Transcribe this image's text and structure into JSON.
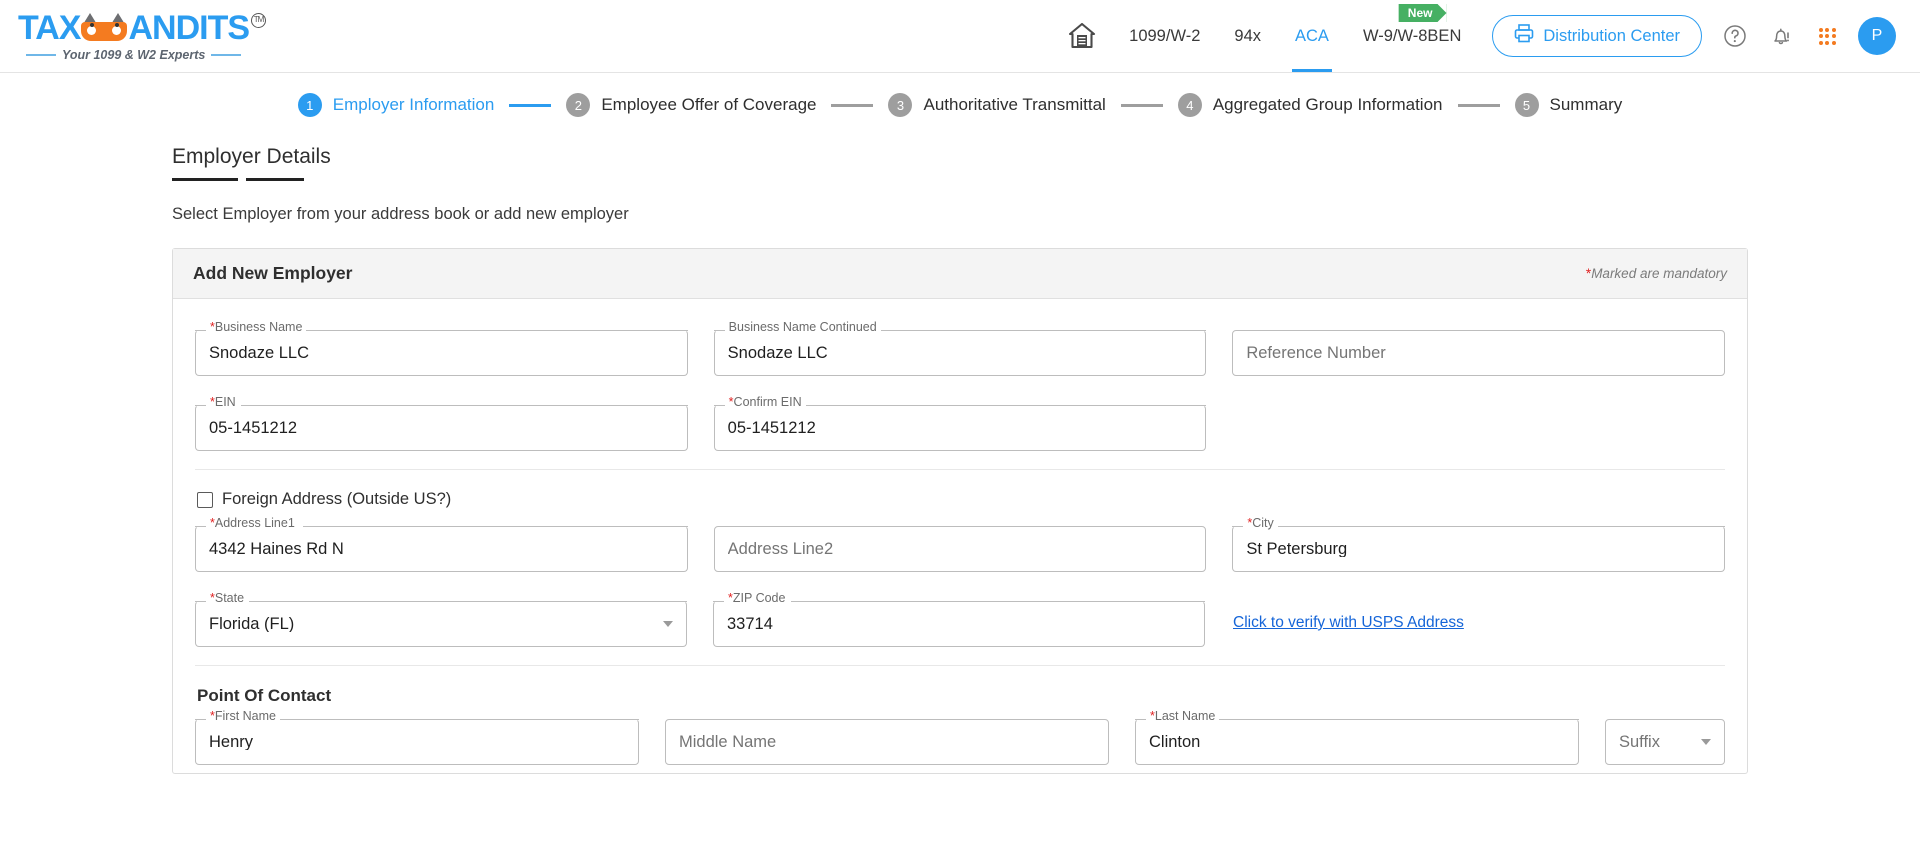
{
  "brand": {
    "logo_tax": "TAX",
    "logo_andits": "ANDITS",
    "trademark": "TM",
    "tagline": "Your 1099 & W2 Experts"
  },
  "topnav": {
    "home_icon": "home-icon",
    "links": [
      {
        "label": "1099/W-2",
        "active": false
      },
      {
        "label": "94x",
        "active": false
      },
      {
        "label": "ACA",
        "active": true
      }
    ],
    "w9_link": "W-9/W-8BEN",
    "new_badge": "New",
    "distribution_button": "Distribution Center",
    "help_icon": "help-circle-icon",
    "bell_icon": "bell-alert-icon",
    "apps_icon": "apps-grid-icon",
    "avatar_initial": "P"
  },
  "stepper": {
    "steps": [
      {
        "num": "1",
        "label": "Employer Information",
        "active": true
      },
      {
        "num": "2",
        "label": "Employee Offer of Coverage",
        "active": false
      },
      {
        "num": "3",
        "label": "Authoritative Transmittal",
        "active": false
      },
      {
        "num": "4",
        "label": "Aggregated Group Information",
        "active": false
      },
      {
        "num": "5",
        "label": "Summary",
        "active": false
      }
    ]
  },
  "page": {
    "title": "Employer Details",
    "subtitle": "Select Employer from your address book or add new employer"
  },
  "card": {
    "header_title": "Add New Employer",
    "mandatory_marker": "*",
    "mandatory_note": "Marked are mandatory"
  },
  "form": {
    "business_name": {
      "label": "Business Name",
      "required": true,
      "value": "Snodaze LLC"
    },
    "business_name_continued": {
      "label": "Business Name Continued",
      "required": false,
      "value": "Snodaze LLC"
    },
    "reference_number": {
      "label": "Reference Number",
      "required": false,
      "value": "",
      "placeholder": "Reference Number"
    },
    "ein": {
      "label": "EIN",
      "required": true,
      "value": "05-1451212"
    },
    "confirm_ein": {
      "label": "Confirm EIN",
      "required": true,
      "value": "05-1451212"
    },
    "foreign_address": {
      "label": "Foreign Address (Outside US?)",
      "checked": false
    },
    "address_line1": {
      "label": "Address Line1",
      "required": true,
      "value": "4342 Haines Rd N"
    },
    "address_line2": {
      "label": "Address Line2",
      "required": false,
      "value": "",
      "placeholder": "Address Line2"
    },
    "city": {
      "label": "City",
      "required": true,
      "value": "St Petersburg"
    },
    "state": {
      "label": "State",
      "required": true,
      "value": "Florida (FL)"
    },
    "zip_code": {
      "label": "ZIP Code",
      "required": true,
      "value": "33714"
    },
    "usps_link": "Click to verify with USPS Address",
    "point_of_contact_heading": "Point Of Contact",
    "first_name": {
      "label": "First Name",
      "required": true,
      "value": "Henry"
    },
    "middle_name": {
      "label": "Middle Name",
      "required": false,
      "value": "",
      "placeholder": "Middle Name"
    },
    "last_name": {
      "label": "Last Name",
      "required": true,
      "value": "Clinton"
    },
    "suffix": {
      "label": "Suffix",
      "required": false,
      "value": "Suffix"
    }
  },
  "colors": {
    "accent": "#2b9cf0",
    "badge_green": "#46b063",
    "orange": "#f47b20",
    "required_red": "#e02020",
    "link_blue": "#1565d8"
  }
}
